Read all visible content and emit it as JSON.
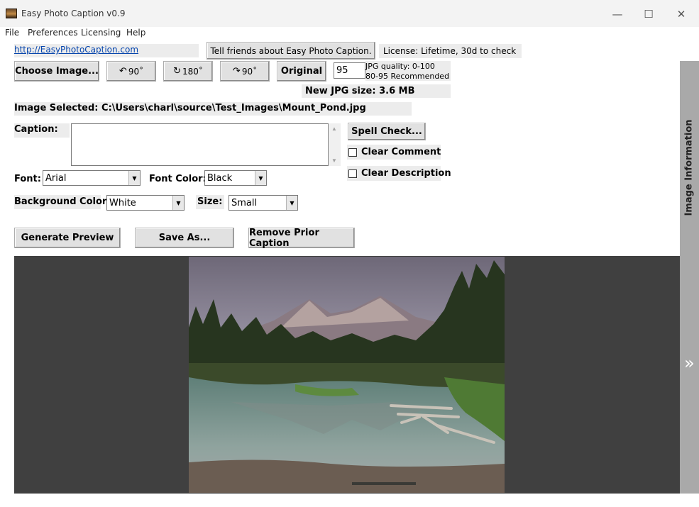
{
  "window": {
    "title": "Easy Photo Caption v0.9",
    "minimize_glyph": "—",
    "maximize_glyph": "☐",
    "close_glyph": "✕"
  },
  "menu": [
    "File",
    "Preferences",
    "Licensing",
    "Help"
  ],
  "toprow": {
    "link": "http://EasyPhotoCaption.com",
    "tell_friends": "Tell friends about Easy Photo Caption.",
    "license": "License: Lifetime, 30d to check"
  },
  "toolbar": {
    "choose_image": "Choose Image...",
    "rotate_left": "90˚",
    "rotate_180": "180˚",
    "rotate_right": "90˚",
    "original": "Original",
    "jpg_quality_value": "95",
    "jpg_quality_hint1": "JPG quality: 0-100",
    "jpg_quality_hint2": "80-95 Recommended",
    "new_size": "New JPG size: 3.6 MB"
  },
  "image_selected": "Image Selected: C:\\Users\\charl\\source\\Test_Images\\Mount_Pond.jpg",
  "caption": {
    "label": "Caption:",
    "value": ""
  },
  "options": {
    "spell_check": "Spell Check...",
    "clear_comment": "Clear Comment",
    "clear_description": "Clear Description"
  },
  "font": {
    "label": "Font:",
    "value": "Arial",
    "color_label": "Font Color:",
    "color_value": "Black"
  },
  "background": {
    "label": "Background Color:",
    "value": "White",
    "size_label": "Size:",
    "size_value": "Small"
  },
  "actions": {
    "generate_preview": "Generate Preview",
    "save_as": "Save As...",
    "remove_prior_caption": "Remove Prior Caption"
  },
  "side_panel": {
    "label": "Image Information",
    "expand_glyph": "»"
  },
  "colors": {
    "preview_bg": "#404040",
    "link": "#0645ad",
    "side_panel": "#a9a9a9"
  }
}
